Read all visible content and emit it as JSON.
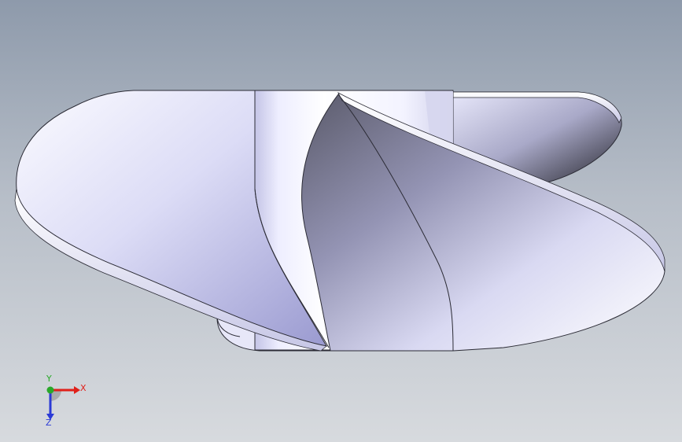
{
  "viewport": {
    "background_top": "#8e9aab",
    "background_bottom": "#d7dade"
  },
  "model": {
    "type": "propeller",
    "blade_count": 3,
    "colors": {
      "blade_light": "#f2f2ff",
      "blade_mid": "#c9c9ec",
      "blade_dark": "#4a4a5e",
      "hub_light": "#ffffff",
      "hub_shade": "#c8c8e6",
      "edge": "#2b2b35"
    }
  },
  "triad": {
    "x_label": "X",
    "y_label": "Y",
    "z_label": "Z",
    "x_color": "#e0201a",
    "y_color": "#2aa82a",
    "z_color": "#2b3ad6"
  }
}
